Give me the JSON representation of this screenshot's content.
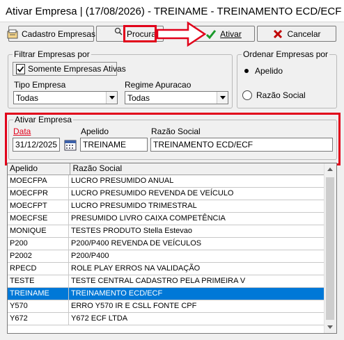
{
  "window": {
    "title": "Ativar Empresa  | (17/08/2026) - TREINAME - TREINAMENTO ECD/ECF"
  },
  "toolbar": {
    "cadastro_label": "Cadastro Empresas",
    "procurar_label": "Procurar",
    "ativar_label": "Ativar",
    "cancelar_label": "Cancelar"
  },
  "filtrar": {
    "legend": "Filtrar Empresas por",
    "somente_ativas_label": "Somente Empresas Ativas",
    "somente_ativas_checked": true,
    "tipo_label": "Tipo Empresa",
    "tipo_value": "Todas",
    "regime_label": "Regime Apuracao",
    "regime_value": "Todas"
  },
  "ordenar": {
    "legend": "Ordenar Empresas por",
    "apelido_label": "Apelido",
    "razao_label": "Razão Social",
    "selected": "Apelido"
  },
  "ativar_empresa": {
    "legend": "Ativar Empresa",
    "data_label": "Data",
    "data_value": "31/12/2025",
    "apelido_label": "Apelido",
    "apelido_value": "TREINAME",
    "razao_label": "Razão Social",
    "razao_value": "TREINAMENTO ECD/ECF"
  },
  "grid": {
    "columns": [
      "Apelido",
      "Razão Social"
    ],
    "rows": [
      {
        "apelido": "MOECFPA",
        "razao": "LUCRO PRESUMIDO ANUAL"
      },
      {
        "apelido": "MOECFPR",
        "razao": "LUCRO PRESUMIDO REVENDA DE VEÍCULO"
      },
      {
        "apelido": "MOECFPT",
        "razao": "LUCRO PRESUMIDO TRIMESTRAL"
      },
      {
        "apelido": "MOECFSE",
        "razao": "PRESUMIDO LIVRO CAIXA COMPETÊNCIA"
      },
      {
        "apelido": "MONIQUE",
        "razao": "TESTES PRODUTO Stella Estevao"
      },
      {
        "apelido": "P200",
        "razao": "P200/P400  REVENDA DE VEÍCULOS"
      },
      {
        "apelido": "P2002",
        "razao": "P200/P400"
      },
      {
        "apelido": "RPECD",
        "razao": "ROLE PLAY ERROS NA VALIDAÇÃO"
      },
      {
        "apelido": "TESTE",
        "razao": "TESTE CENTRAL CADASTRO PELA PRIMEIRA V"
      },
      {
        "apelido": "TREINAME",
        "razao": "TREINAMENTO ECD/ECF"
      },
      {
        "apelido": "Y570",
        "razao": "ERRO Y570 IR E CSLL FONTE CPF"
      },
      {
        "apelido": "Y672",
        "razao": "Y672 ECF LTDA"
      }
    ],
    "selected_index": 9
  },
  "colors": {
    "highlight_red": "#e1001a",
    "selection_blue": "#0078d7",
    "check_green": "#1a9a2a",
    "cancel_red": "#c00000"
  },
  "icons": [
    "folder-card-icon",
    "search-icon",
    "green-check-icon",
    "red-x-icon",
    "calendar-icon",
    "red-arrow-annotation"
  ]
}
